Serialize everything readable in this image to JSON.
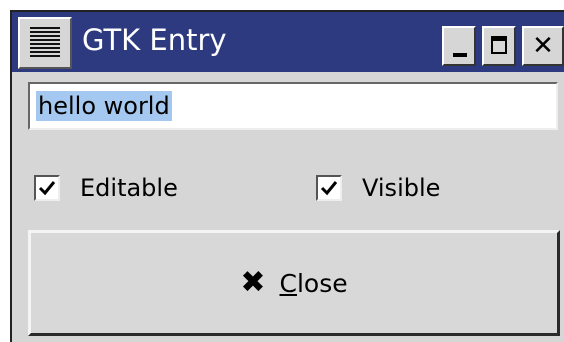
{
  "window": {
    "title": "GTK Entry",
    "controls": {
      "minimize_icon": "minimize-icon",
      "maximize_icon": "maximize-icon",
      "close_glyph": "✕"
    }
  },
  "entry": {
    "value": "hello world",
    "selected": true
  },
  "checkboxes": {
    "editable": {
      "label": "Editable",
      "checked": true
    },
    "visible": {
      "label": "Visible",
      "checked": true
    }
  },
  "close_button": {
    "icon": "✖",
    "mnemonic": "C",
    "label_rest": "lose"
  },
  "colors": {
    "titlebar": "#2d3a80",
    "selection": "#a4c8ef",
    "window_bg": "#d6d6d6"
  }
}
